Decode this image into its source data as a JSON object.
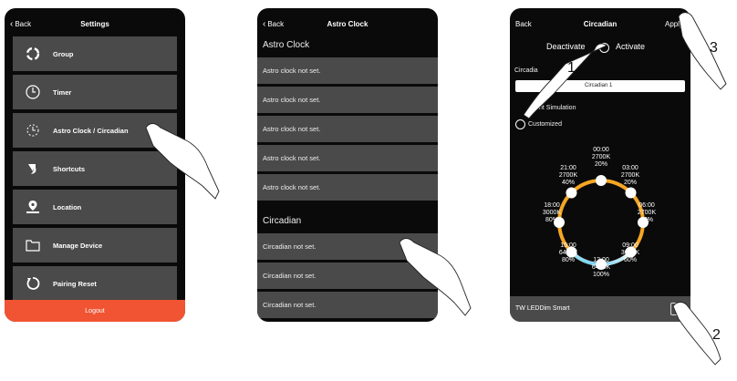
{
  "phone1": {
    "nav": {
      "back": "Back",
      "title": "Settings"
    },
    "menu": [
      {
        "label": "Group",
        "icon": "group-icon"
      },
      {
        "label": "Timer",
        "icon": "clock-icon"
      },
      {
        "label": "Astro Clock / Circadian",
        "icon": "astro-clock-icon"
      },
      {
        "label": "Shortcuts",
        "icon": "shortcut-arrow-icon"
      },
      {
        "label": "Location",
        "icon": "location-pin-icon"
      },
      {
        "label": "Manage Device",
        "icon": "folder-icon"
      },
      {
        "label": "Pairing Reset",
        "icon": "reset-icon"
      }
    ],
    "logout": "Logout"
  },
  "phone2": {
    "nav": {
      "back": "Back",
      "title": "Astro Clock"
    },
    "astro_header": "Astro Clock",
    "astro_rows": [
      "Astro clock not set.",
      "Astro clock not set.",
      "Astro clock not set.",
      "Astro clock not set.",
      "Astro clock not set."
    ],
    "circadian_header": "Circadian",
    "circadian_rows": [
      "Circadian not set.",
      "Circadian not set.",
      "Circadian not set."
    ]
  },
  "phone3": {
    "nav": {
      "back": "Back",
      "title": "Circadian",
      "apply": "Apply"
    },
    "deactivate": "Deactivate",
    "activate": "Activate",
    "circadian_label": "Circadia",
    "name_value": "Circadian 1",
    "simulation_label": "nt Simulation",
    "customized_label": "Customized",
    "nodes": [
      {
        "time": "00:00",
        "temp": "2700K",
        "level": "20%"
      },
      {
        "time": "03:00",
        "temp": "2700K",
        "level": "20%"
      },
      {
        "time": "06:00",
        "temp": "2700K",
        "level": "30%"
      },
      {
        "time": "09:00",
        "temp": "3000K",
        "level": "60%"
      },
      {
        "time": "12:00",
        "temp": "6425K",
        "level": "100%"
      },
      {
        "time": "15:00",
        "temp": "6425K",
        "level": "80%"
      },
      {
        "time": "18:00",
        "temp": "3000K",
        "level": "80%"
      },
      {
        "time": "21:00",
        "temp": "2700K",
        "level": "40%"
      }
    ],
    "device_name": "TW LEDDim Smart"
  },
  "callouts": {
    "one": "1",
    "two": "2",
    "three": "3"
  },
  "colors": {
    "menu_bg": "#4a4a4a",
    "logout": "#f05432",
    "ring_warm": "#f5a623",
    "ring_cool": "#5bc8f0"
  }
}
